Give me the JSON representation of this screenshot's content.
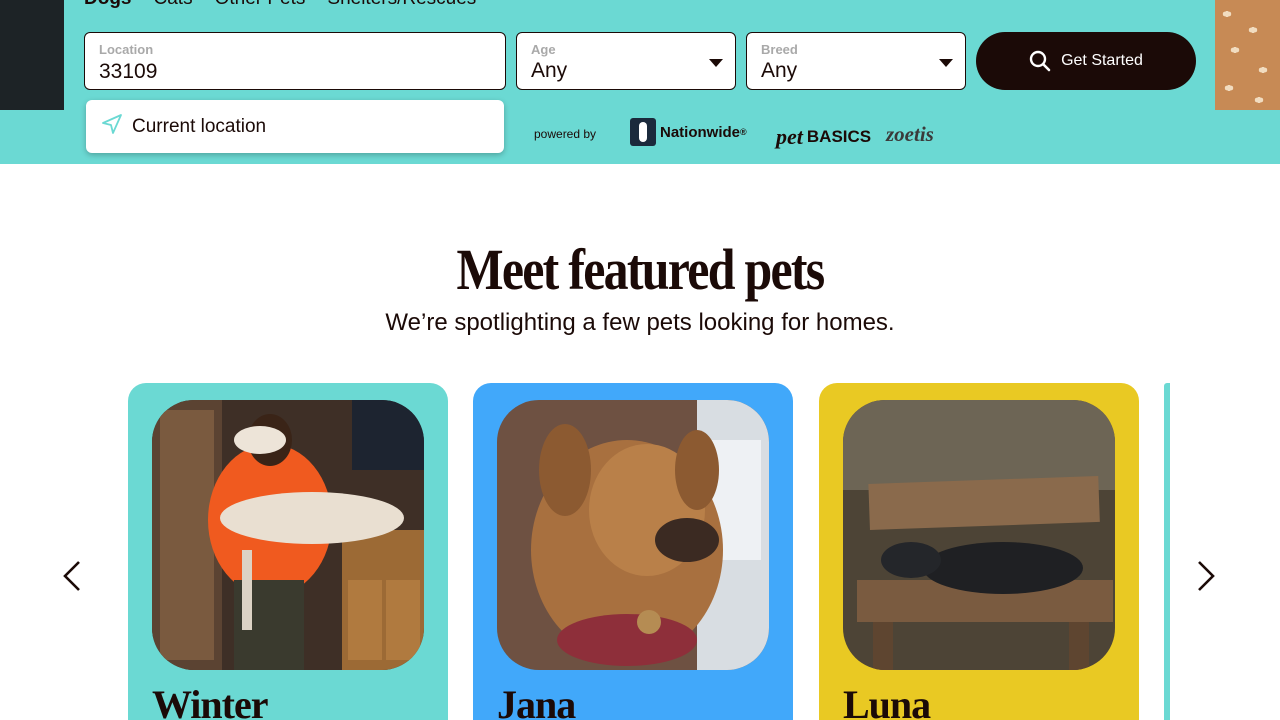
{
  "pet_tabs": [
    "Dogs",
    "Cats",
    "Other Pets",
    "Shelters/Rescues"
  ],
  "search": {
    "location_label": "Location",
    "location_value": "33109",
    "age_label": "Age",
    "age_value": "Any",
    "breed_label": "Breed",
    "breed_value": "Any",
    "cta_label": "Get Started",
    "dropdown_option": "Current location"
  },
  "sponsors": {
    "powered_by": "powered by",
    "nationwide": "Nationwide",
    "nationwide_mark": "®",
    "petbasics_a": "pet",
    "petbasics_b": "BASICS",
    "zoetis": "zoetis"
  },
  "featured": {
    "title": "Meet featured pets",
    "subtitle": "We’re spotlighting a few pets looking for homes."
  },
  "pets": [
    {
      "name": "Winter",
      "card_color": "#6bd9d3"
    },
    {
      "name": "Jana",
      "card_color": "#41a8fa"
    },
    {
      "name": "Luna",
      "card_color": "#e9c923"
    }
  ],
  "colors": {
    "hero_bg": "#6bd9d3",
    "cta_bg": "#1b0a07",
    "text_dark": "#1b0a07"
  },
  "icons": {
    "search": "search-icon",
    "location": "location-arrow-icon",
    "caret": "chevron-down-icon",
    "prev": "chevron-left-icon",
    "next": "chevron-right-icon"
  }
}
